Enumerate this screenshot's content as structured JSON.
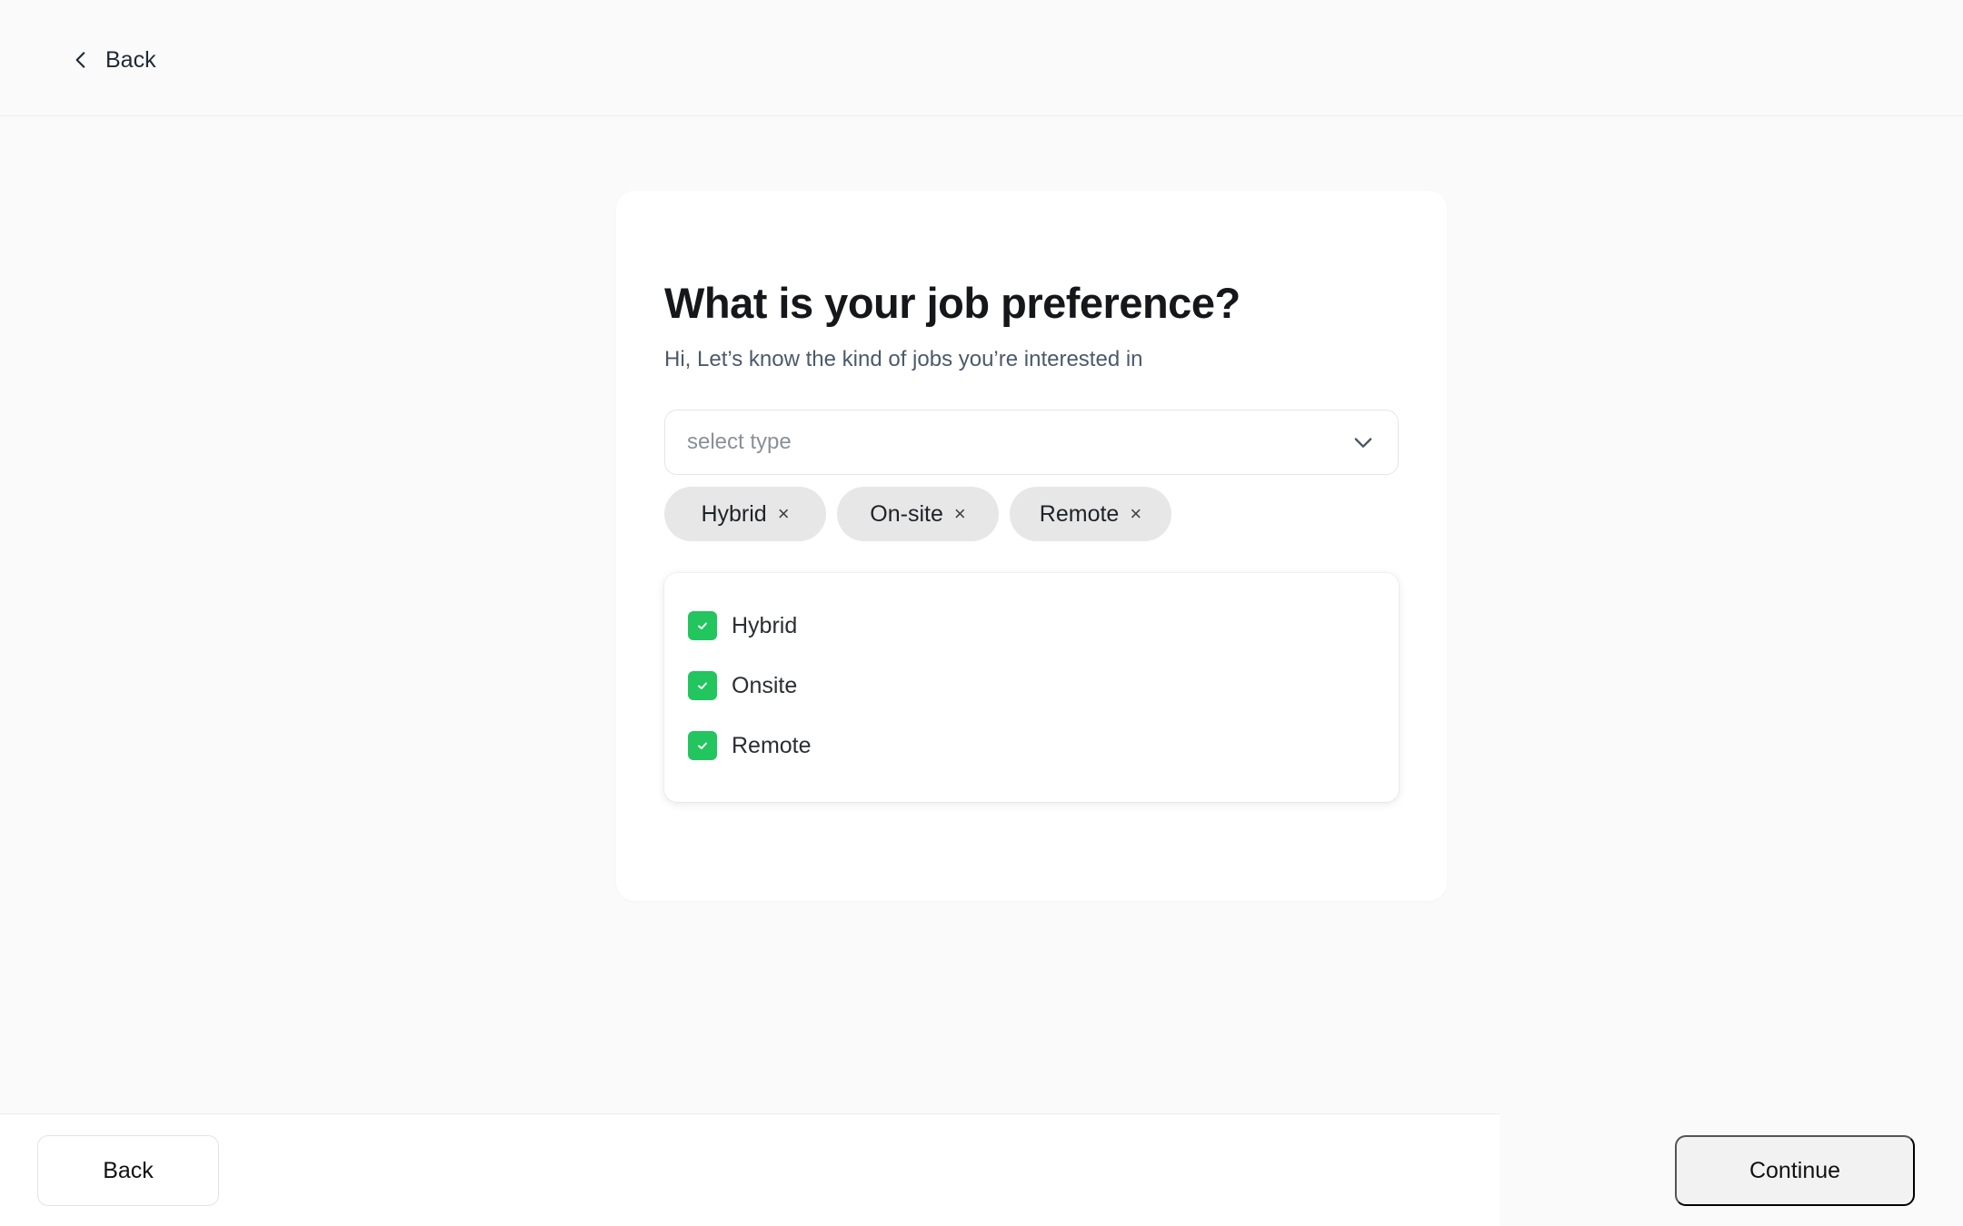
{
  "header": {
    "back_label": "Back"
  },
  "card": {
    "title": "What is your job preference?",
    "subtitle": "Hi, Let’s know the kind of jobs you’re interested in"
  },
  "select": {
    "placeholder": "select type"
  },
  "chips": [
    {
      "label": "Hybrid",
      "remove": "×"
    },
    {
      "label": "On-site",
      "remove": "×"
    },
    {
      "label": "Remote",
      "remove": "×"
    }
  ],
  "options": [
    {
      "label": "Hybrid",
      "checked": true
    },
    {
      "label": "Onsite",
      "checked": true
    },
    {
      "label": "Remote",
      "checked": true
    }
  ],
  "footer": {
    "back_label": "Back",
    "continue_label": "Continue"
  },
  "colors": {
    "accent_green": "#22c55e",
    "chip_bg": "#e7e7e7",
    "page_bg": "#fafafa"
  }
}
